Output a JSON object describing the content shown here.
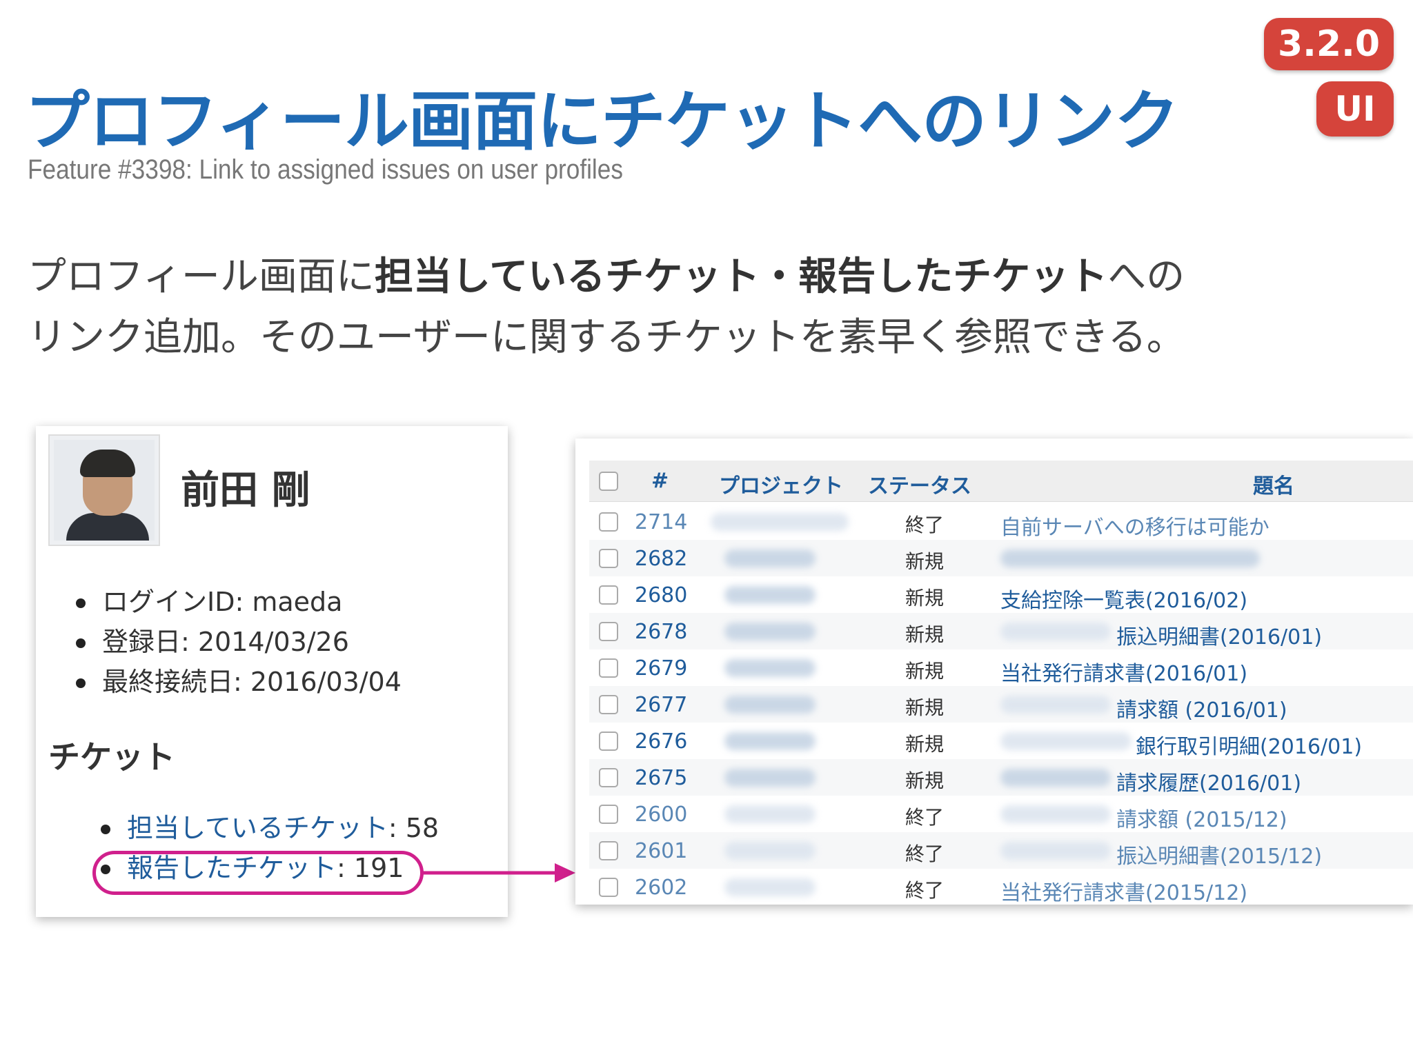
{
  "title": "プロフィール画面にチケットへのリンク",
  "subtitle": "Feature #3398: Link to assigned issues on user profiles",
  "badges": {
    "version": "3.2.0",
    "category": "UI"
  },
  "description": {
    "line1_pre": "プロフィール画面に",
    "line1_bold": "担当しているチケット・報告したチケット",
    "line1_post": "への",
    "line2": "リンク追加。そのユーザーに関するチケットを素早く参照できる。"
  },
  "profile": {
    "name": "前田 剛",
    "info": [
      "ログインID: maeda",
      "登録日: 2014/03/26",
      "最終接続日: 2016/03/04"
    ],
    "tickets_heading": "チケット",
    "assigned_label": "担当しているチケット",
    "assigned_count": ": 58",
    "reported_label": "報告したチケット",
    "reported_count": ": 191"
  },
  "issues_table": {
    "columns": [
      "#",
      "プロジェクト",
      "ステータス",
      "題名"
    ],
    "rows": [
      {
        "id": "2714",
        "status": "終了",
        "subject": "自前サーバへの移行は可能か"
      },
      {
        "id": "2682",
        "status": "新規",
        "subject": ""
      },
      {
        "id": "2680",
        "status": "新規",
        "subject": "支給控除一覧表(2016/02)"
      },
      {
        "id": "2678",
        "status": "新規",
        "subject": "振込明細書(2016/01)"
      },
      {
        "id": "2679",
        "status": "新規",
        "subject": "当社発行請求書(2016/01)"
      },
      {
        "id": "2677",
        "status": "新規",
        "subject": "請求額 (2016/01)"
      },
      {
        "id": "2676",
        "status": "新規",
        "subject": "銀行取引明細(2016/01)"
      },
      {
        "id": "2675",
        "status": "新規",
        "subject": "請求履歴(2016/01)"
      },
      {
        "id": "2600",
        "status": "終了",
        "subject": "請求額 (2015/12)"
      },
      {
        "id": "2601",
        "status": "終了",
        "subject": "振込明細書(2015/12)"
      },
      {
        "id": "2602",
        "status": "終了",
        "subject": "当社発行請求書(2015/12)"
      }
    ]
  },
  "colors": {
    "title": "#1f6ab4",
    "badge": "#d5443b",
    "link": "#1f5c9b",
    "highlight": "#d0208c"
  }
}
